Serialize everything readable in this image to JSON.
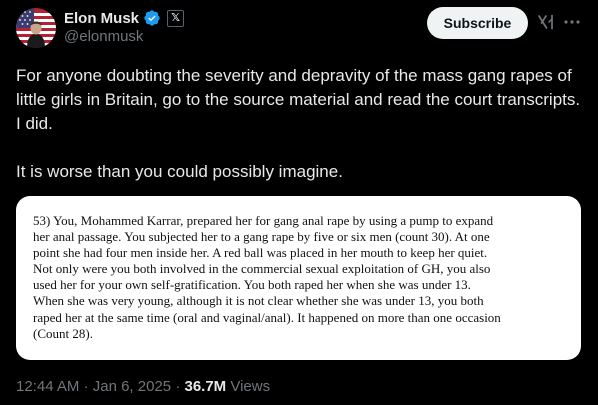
{
  "author": {
    "display_name": "Elon Musk",
    "handle": "@elonmusk",
    "affiliate_badge": "𝕏"
  },
  "icons": {
    "verified": "verified-badge-icon",
    "grok": "grok-icon",
    "more": "more-horizontal-icon"
  },
  "colors": {
    "verified_blue": "#1d9bf0",
    "muted_text": "#71767b",
    "primary_text": "#e7e9ea",
    "subscribe_bg": "#eff3f4"
  },
  "actions": {
    "subscribe_label": "Subscribe"
  },
  "tweet": {
    "paragraphs": [
      "For anyone doubting the severity and depravity of the mass gang rapes of little girls in Britain, go to the source material and read the court transcripts. I did.",
      "It is worse than you could possibly imagine."
    ],
    "media_text": [
      "53)  You, Mohammed Karrar, prepared her for gang anal rape by using a pump to expand",
      "her anal passage.  You subjected her to a gang rape by five or six men (count 30). At one",
      "point she had four men inside her. A red ball was placed in her mouth to keep her quiet.",
      "Not only were you both involved in the commercial sexual exploitation of  GH, you also",
      "used her for your own self-gratification. You both raped her when she was under 13.",
      "When she was very young, although it is not clear whether she was under 13, you both",
      "raped her at the same time (oral and vaginal/anal). It happened on more than one occasion",
      "(Count 28)."
    ]
  },
  "meta": {
    "time": "12:44 AM",
    "separator": "·",
    "date": "Jan 6, 2025",
    "views_count": "36.7M",
    "views_label": "Views"
  }
}
